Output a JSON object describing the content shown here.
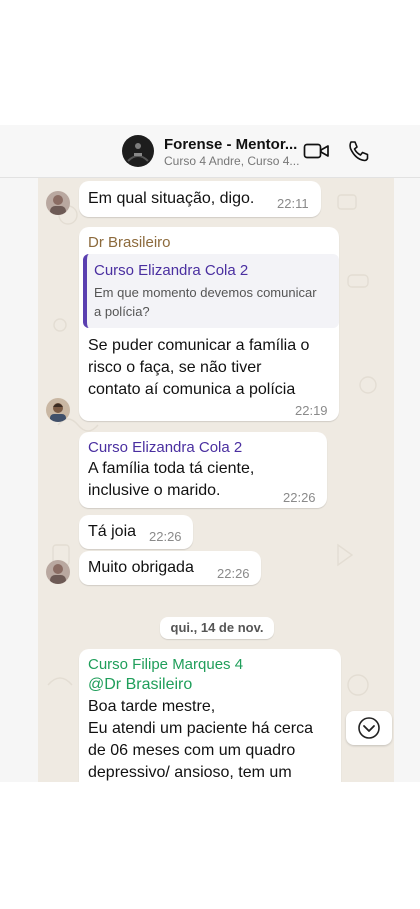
{
  "header": {
    "title": "Forense - Mentor...",
    "subtitle": "Curso 4 Andre, Curso 4..."
  },
  "messages": [
    {
      "text": "Em qual situação, digo.",
      "time": "22:11"
    },
    {
      "sender": "Dr Brasileiro",
      "sender_color": "#8c6a3c",
      "quote": {
        "author": "Curso Elizandra Cola 2",
        "text_line1": "Em que momento devemos comunicar",
        "text_line2": "a polícia?"
      },
      "lines": [
        "Se puder comunicar a família o",
        "risco o faça, se não tiver",
        "contato aí comunica a polícia"
      ],
      "time": "22:19"
    },
    {
      "sender": "Curso Elizandra Cola 2",
      "sender_color": "#4a2fa0",
      "lines": [
        "A família toda tá ciente,",
        "inclusive o marido."
      ],
      "time": "22:26"
    },
    {
      "text": "Tá joia",
      "time": "22:26"
    },
    {
      "text": "Muito obrigada",
      "time": "22:26"
    }
  ],
  "date_separator": "qui., 14 de nov.",
  "last_message": {
    "sender": "Curso Filipe Marques 4",
    "sender_color": "#1f9e5a",
    "mention": "@Dr Brasileiro",
    "lines": [
      "Boa tarde mestre,",
      "Eu atendi um paciente há cerca",
      "de 06 meses com um quadro",
      "depressivo/ ansioso, tem um"
    ]
  },
  "icons": {
    "video_call": "video-camera-icon",
    "voice_call": "phone-icon",
    "scroll_down": "chevron-down-icon"
  },
  "colors": {
    "chat_background": "#efeae2",
    "quote_bar": "#5a3fb0",
    "mention": "#1f9e5a"
  }
}
